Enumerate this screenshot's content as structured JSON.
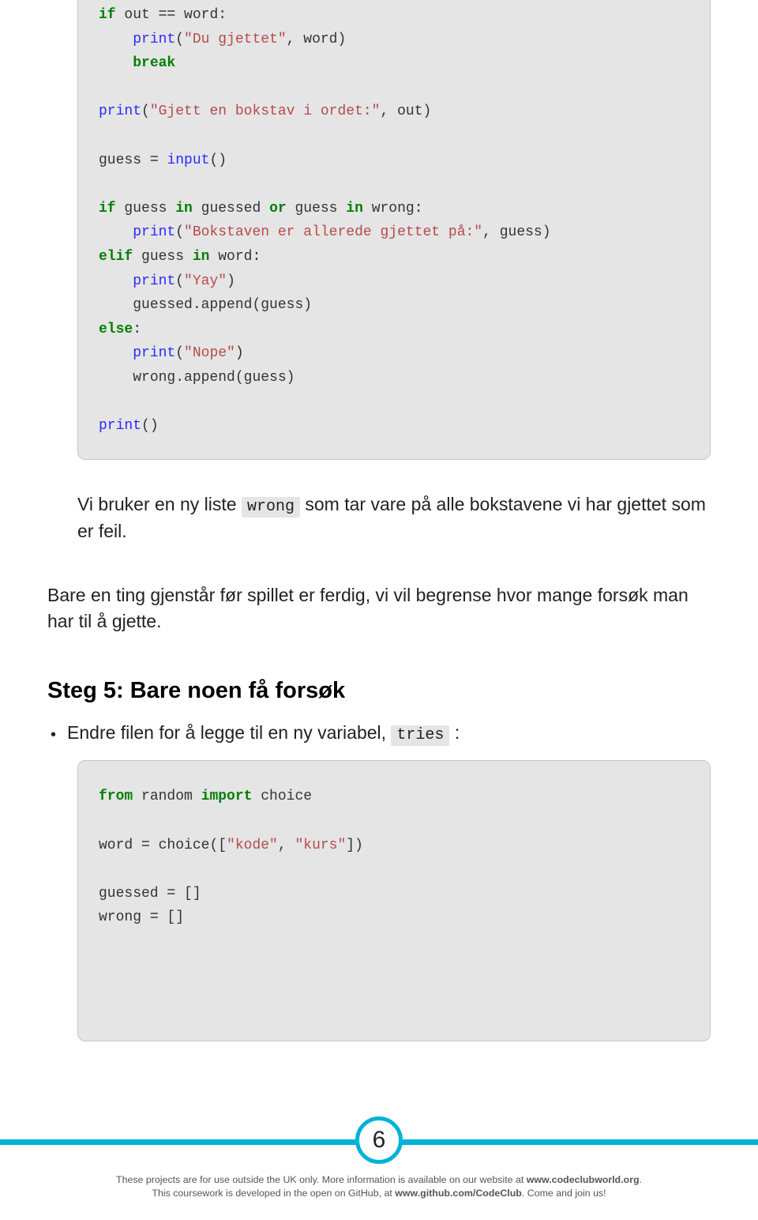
{
  "code1": {
    "l1a": "if",
    "l1b": " out ",
    "l1c": "==",
    "l1d": " word:",
    "l2a": "print",
    "l2b": "(",
    "l2c": "\"Du gjettet\"",
    "l2d": ", word)",
    "l3": "break",
    "l4a": "print",
    "l4b": "(",
    "l4c": "\"Gjett en bokstav i ordet:\"",
    "l4d": ", out)",
    "l5a": "guess ",
    "l5b": "=",
    "l5c": " ",
    "l5d": "input",
    "l5e": "()",
    "l6a": "if",
    "l6b": " guess ",
    "l6c": "in",
    "l6d": " guessed ",
    "l6e": "or",
    "l6f": " guess ",
    "l6g": "in",
    "l6h": " wrong:",
    "l7a": "print",
    "l7b": "(",
    "l7c": "\"Bokstaven er allerede gjettet på:\"",
    "l7d": ", guess)",
    "l8a": "elif",
    "l8b": " guess ",
    "l8c": "in",
    "l8d": " word:",
    "l9a": "print",
    "l9b": "(",
    "l9c": "\"Yay\"",
    "l9d": ")",
    "l10": "guessed.append(guess)",
    "l11a": "else",
    "l11b": ":",
    "l12a": "print",
    "l12b": "(",
    "l12c": "\"Nope\"",
    "l12d": ")",
    "l13": "wrong.append(guess)",
    "l14a": "print",
    "l14b": "()"
  },
  "desc": {
    "t1": "Vi bruker en ny liste ",
    "code": "wrong",
    "t2": " som tar vare på alle bokstavene vi har gjettet som er feil."
  },
  "para": "Bare en ting gjenstår før spillet er ferdig, vi vil begrense hvor mange forsøk man har til å gjette.",
  "step": "Steg 5: Bare noen få forsøk",
  "bullet": {
    "t1": "Endre filen for å legge til en ny variabel, ",
    "code": "tries",
    "t2": " :"
  },
  "code2": {
    "l1a": "from",
    "l1b": " random ",
    "l1c": "import",
    "l1d": " choice",
    "l2a": "word ",
    "l2b": "=",
    "l2c": " choice([",
    "l2d": "\"kode\"",
    "l2e": ", ",
    "l2f": "\"kurs\"",
    "l2g": "])",
    "l3a": "guessed ",
    "l3b": "=",
    "l3c": " []",
    "l4a": "wrong ",
    "l4b": "=",
    "l4c": " []"
  },
  "footer": {
    "pageNum": "6",
    "line1a": "These projects are for use outside the UK only. More information is available on our website at ",
    "line1b": "www.codeclubworld.org",
    "line1c": ".",
    "line2a": "This coursework is developed in the open on GitHub, at ",
    "line2b": "www.github.com/CodeClub",
    "line2c": ". Come and join us!"
  }
}
